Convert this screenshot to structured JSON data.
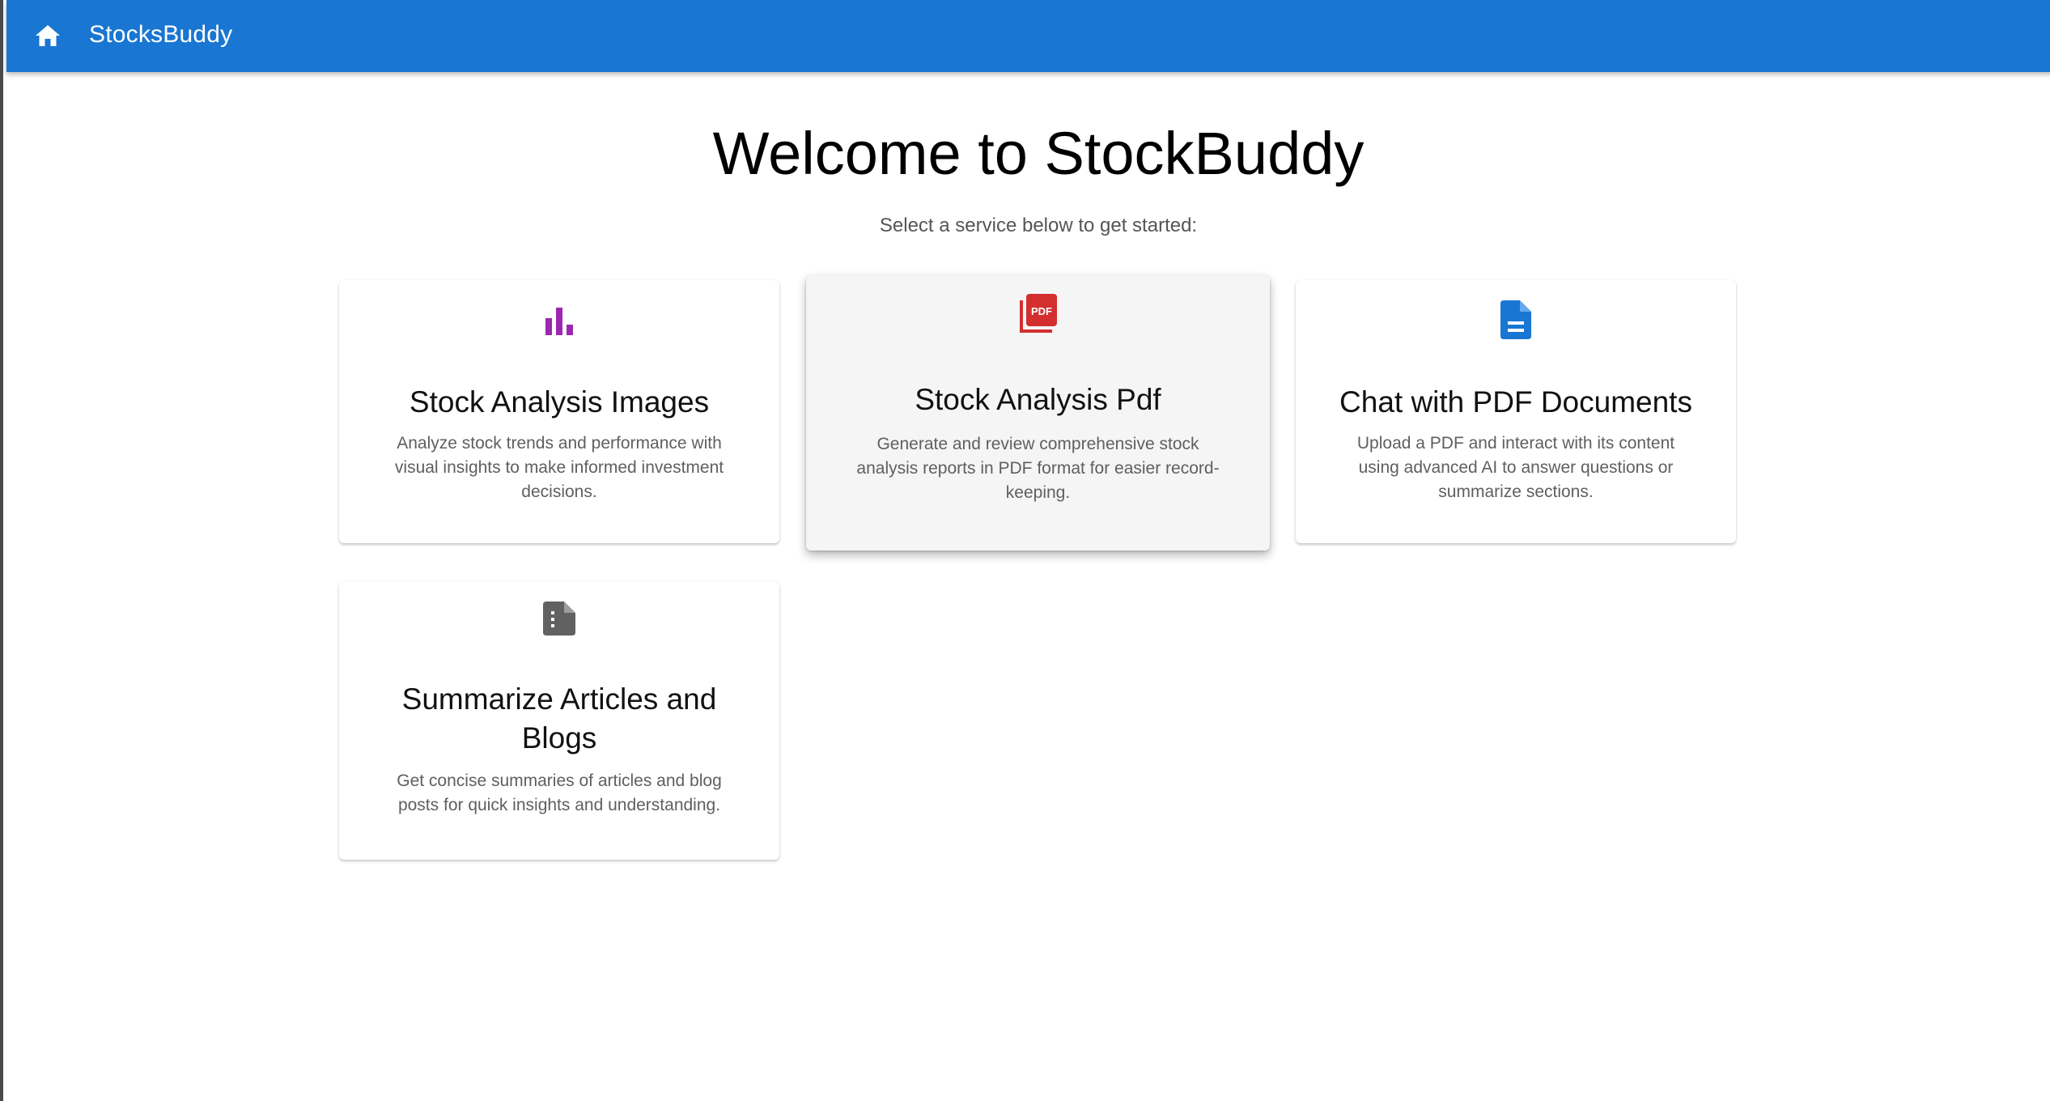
{
  "appbar": {
    "title": "StocksBuddy",
    "home_icon": "home-icon",
    "color": "#1976d2"
  },
  "main": {
    "heading": "Welcome to StockBuddy",
    "subheading": "Select a service below to get started:"
  },
  "cards": [
    {
      "title": "Stock Analysis Images",
      "description": "Analyze stock trends and performance with visual insights to make informed investment decisions.",
      "icon": "bar-chart-icon",
      "icon_color": "#9c27b0"
    },
    {
      "title": "Stock Analysis Pdf",
      "description": "Generate and review comprehensive stock analysis reports in PDF format for easier record-keeping.",
      "icon": "pdf-icon",
      "icon_color": "#d32f2f",
      "icon_text": "PDF"
    },
    {
      "title": "Chat with PDF Documents",
      "description": "Upload a PDF and interact with its content using advanced AI to answer questions or summarize sections.",
      "icon": "document-icon",
      "icon_color": "#1976d2"
    },
    {
      "title": "Summarize Articles and Blogs",
      "description": "Get concise summaries of articles and blog posts for quick insights and understanding.",
      "icon": "article-icon",
      "icon_color": "#616161"
    }
  ]
}
